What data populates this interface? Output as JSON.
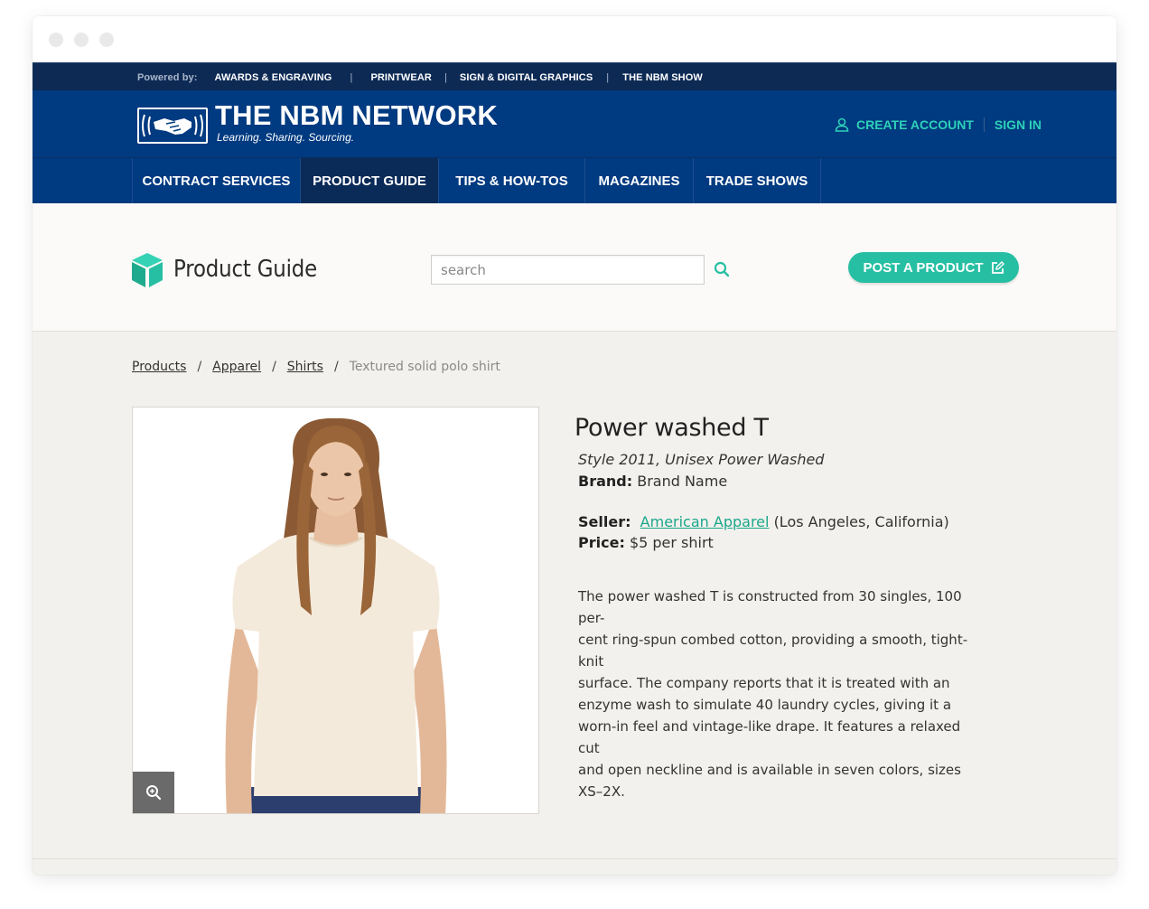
{
  "topbar": {
    "powered_by": "Powered by:",
    "links": [
      "AWARDS & ENGRAVING",
      "PRINTWEAR",
      "SIGN & DIGITAL GRAPHICS",
      "THE NBM SHOW"
    ],
    "separator": "|"
  },
  "header": {
    "logo_title": "THE NBM NETWORK",
    "logo_tagline": "Learning. Sharing. Sourcing.",
    "create_account": "CREATE ACCOUNT",
    "sign_in": "SIGN IN"
  },
  "nav": {
    "items": [
      "CONTRACT SERVICES",
      "PRODUCT GUIDE",
      "TIPS & HOW-TOS",
      "MAGAZINES",
      "TRADE SHOWS"
    ],
    "active": "PRODUCT GUIDE"
  },
  "guide": {
    "title": "Product Guide",
    "search_placeholder": "search",
    "post_button": "POST A PRODUCT"
  },
  "breadcrumb": {
    "items": [
      "Products",
      "Apparel",
      "Shirts"
    ],
    "current": "Textured solid polo shirt",
    "separator": "/"
  },
  "product": {
    "title": "Power washed T",
    "style": "Style 2011, Unisex Power Washed",
    "brand_label": "Brand:",
    "brand": "Brand Name",
    "seller_label": "Seller:",
    "seller": "American Apparel",
    "seller_location": "(Los Angeles, California)",
    "price_label": "Price:",
    "price": "$5 per shirt",
    "description_lines": [
      "The power washed T is constructed from 30 singles, 100 per-",
      "cent ring-spun combed cotton, providing a smooth, tight-knit",
      "surface. The company reports that it is treated with an",
      "enzyme wash to simulate 40 laundry cycles, giving it a",
      "worn-in feel and vintage-like drape. It features a relaxed cut",
      "and open neckline and is available in seven colors, sizes",
      "XS–2X."
    ]
  },
  "colors": {
    "navy_dark": "#0d2a55",
    "navy": "#003a80",
    "teal": "#27bfa3",
    "teal_text": "#2ed1b9",
    "page_bg": "#f3f1ed"
  },
  "icons": {
    "account": "user-icon",
    "search": "search-icon",
    "post": "edit-icon",
    "zoom": "zoom-in-icon",
    "guide": "cube-icon",
    "logo": "handshake-icon"
  }
}
